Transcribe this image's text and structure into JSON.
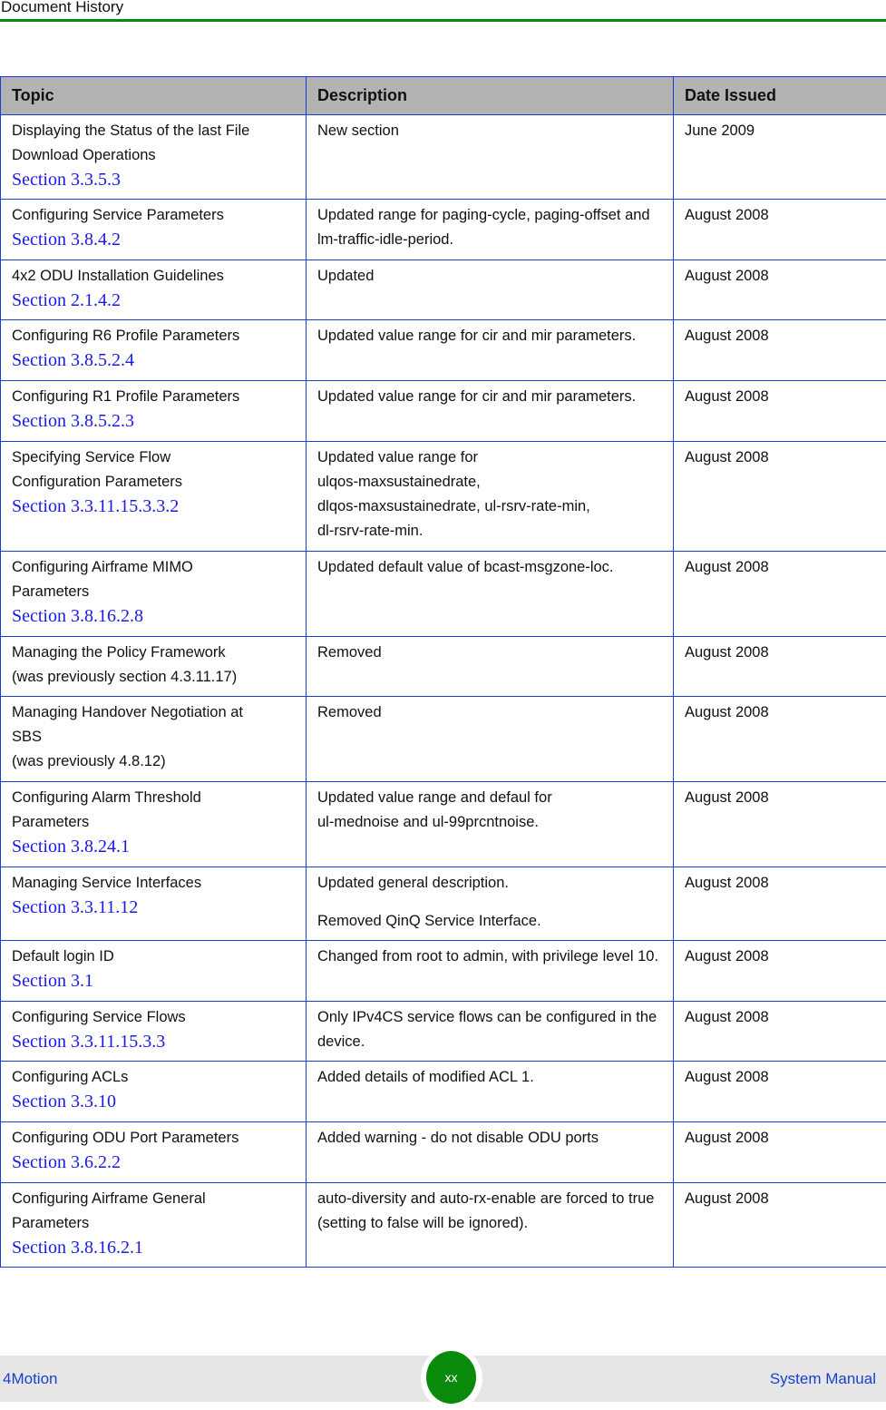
{
  "header": {
    "title": "Document History"
  },
  "table": {
    "columns": [
      "Topic",
      "Description",
      "Date Issued"
    ],
    "rows": [
      {
        "topic": [
          "Displaying the Status of the last File",
          "Download Operations"
        ],
        "section": "Section 3.3.5.3",
        "description": [
          "New section"
        ],
        "date": "June 2009",
        "height": 93
      },
      {
        "topic": [
          "Configuring Service Parameters"
        ],
        "section": "Section 3.8.4.2",
        "description": [
          "Updated range for paging-cycle, paging-offset and lm-traffic-idle-period."
        ],
        "date": "August 2008"
      },
      {
        "topic": [
          "4x2 ODU Installation Guidelines"
        ],
        "section": "Section 2.1.4.2",
        "description": [
          "Updated"
        ],
        "date": "August 2008"
      },
      {
        "topic": [
          "Configuring R6 Profile Parameters"
        ],
        "section": "Section 3.8.5.2.4",
        "description": [
          "Updated value range for cir and mir parameters."
        ],
        "date": "August 2008"
      },
      {
        "topic": [
          "Configuring R1 Profile Parameters"
        ],
        "section": "Section 3.8.5.2.3",
        "description": [
          "Updated value range for cir and mir parameters."
        ],
        "date": "August 2008"
      },
      {
        "topic": [
          "Specifying Service Flow",
          "Configuration Parameters"
        ],
        "section": "Section 3.3.11.15.3.3.2",
        "description": [
          "Updated value range for",
          "ulqos-maxsustainedrate,",
          "dlqos-maxsustainedrate, ul-rsrv-rate-min,",
          "dl-rsrv-rate-min."
        ],
        "date": "August 2008"
      },
      {
        "topic": [
          "Configuring Airframe MIMO",
          "Parameters"
        ],
        "section": "Section 3.8.16.2.8",
        "description": [
          "Updated default value of bcast-msgzone-loc."
        ],
        "date": "August 2008"
      },
      {
        "topic": [
          "Managing the Policy Framework",
          "(was previously section 4.3.11.17)"
        ],
        "section": "",
        "description": [
          "Removed"
        ],
        "date": "August 2008"
      },
      {
        "topic": [
          "Managing Handover Negotiation at",
          "SBS",
          "(was previously 4.8.12)"
        ],
        "section": "",
        "description": [
          "Removed"
        ],
        "date": "August 2008"
      },
      {
        "topic": [
          "Configuring Alarm Threshold",
          "Parameters"
        ],
        "section": "Section 3.8.24.1",
        "description": [
          "Updated value range and defaul for",
          "ul-mednoise and ul-99prcntnoise."
        ],
        "date": "August 2008"
      },
      {
        "topic": [
          "Managing Service Interfaces"
        ],
        "section": "Section 3.3.11.12",
        "description": [
          "Updated general description.",
          "Removed QinQ Service Interface."
        ],
        "desc_paragraphs": true,
        "date": "August 2008"
      },
      {
        "topic": [
          "Default login ID"
        ],
        "section": "Section 3.1",
        "description": [
          "Changed from root to admin, with privilege level 10."
        ],
        "date": "August 2008"
      },
      {
        "topic": [
          "Configuring Service Flows"
        ],
        "section": "Section 3.3.11.15.3.3",
        "description": [
          "Only IPv4CS service flows can be configured in the device."
        ],
        "date": "August 2008"
      },
      {
        "topic": [
          "Configuring ACLs"
        ],
        "section": "Section 3.3.10",
        "description": [
          "Added details of modified ACL 1."
        ],
        "date": "August 2008"
      },
      {
        "topic": [
          "Configuring ODU Port Parameters"
        ],
        "section": "Section 3.6.2.2",
        "description": [
          "Added warning - do not disable ODU ports"
        ],
        "date": "August 2008"
      },
      {
        "topic": [
          "Configuring Airframe General",
          "Parameters"
        ],
        "section": "Section 3.8.16.2.1",
        "description": [
          "auto-diversity and auto-rx-enable are forced to true (setting to false will be ignored)."
        ],
        "date": "August 2008"
      }
    ]
  },
  "footer": {
    "product": "4Motion",
    "page_number": "xx",
    "manual": "System Manual"
  },
  "colors": {
    "accent_green": "#0a8a0a",
    "link_blue": "#1a1ae6",
    "border_blue": "#1a3fd0",
    "header_gray": "#b3b3b3"
  }
}
